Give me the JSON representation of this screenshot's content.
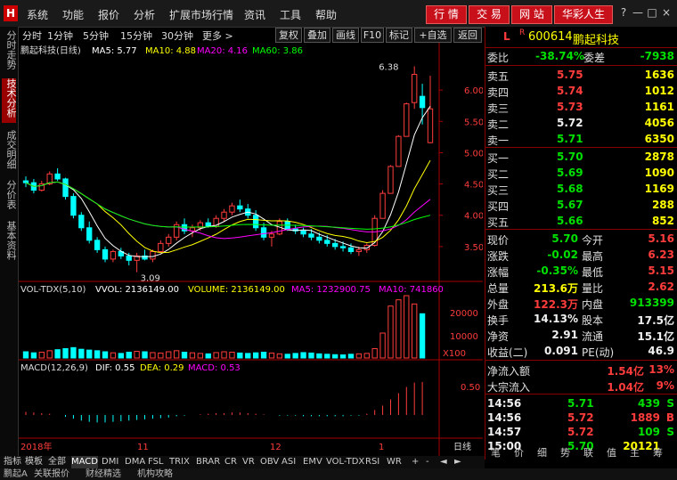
{
  "menubar": {
    "items": [
      "系统",
      "功能",
      "报价",
      "分析",
      "扩展市场行情",
      "资讯",
      "工具",
      "帮助"
    ],
    "buttons": [
      "行 情",
      "交 易",
      "网 站",
      "华彩人生"
    ],
    "controls": [
      "?",
      "—",
      "□",
      "×"
    ]
  },
  "left_tabs": [
    "分时走势",
    "技术分析",
    "成交明细",
    "分价表",
    "基本资料"
  ],
  "periods": [
    "分时",
    "1分钟",
    "5分钟",
    "15分钟",
    "30分钟",
    "更多 >"
  ],
  "tools": [
    "复权",
    "叠加",
    "画线",
    "F10",
    "标记",
    "+自选",
    "返回"
  ],
  "chart_header": {
    "name": "鹏起科技(日线)",
    "ma5": "MA5: 5.77",
    "ma10": "MA10: 4.88",
    "ma20": "MA20: 4.16",
    "ma60": "MA60: 3.86"
  },
  "price_axis": [
    "6.00",
    "5.50",
    "5.00",
    "4.50",
    "4.00",
    "3.50"
  ],
  "annotations": {
    "high": "6.38",
    "low": "3.09"
  },
  "vol_header": {
    "name": "VOL-TDX(5,10)",
    "vvol": "VVOL: 2136149.00",
    "volume": "VOLUME: 2136149.00",
    "ma5": "MA5: 1232900.75",
    "ma10": "MA10: 741860"
  },
  "vol_axis": [
    "20000",
    "10000"
  ],
  "vol_unit": "X100",
  "macd_header": {
    "name": "MACD(12,26,9)",
    "dif": "DIF: 0.55",
    "dea": "DEA: 0.29",
    "macd": "MACD: 0.53"
  },
  "macd_axis": [
    "0.50"
  ],
  "date_axis": [
    "2018年",
    "11",
    "12",
    "1"
  ],
  "date_unit": "日线",
  "bottom_tabs": [
    "指标",
    "模板",
    "全部",
    "MACD",
    "DMI",
    "DMA",
    "FSL",
    "TRIX",
    "BRAR",
    "CR",
    "VR",
    "OBV",
    "ASI",
    "EMV",
    "VOL-TDX",
    "RSI",
    "WR"
  ],
  "bottom_controls": [
    "+",
    "-",
    "◄",
    "►"
  ],
  "status_items": [
    "鹏起A",
    "关联报价",
    "财经精选",
    "机构攻略"
  ],
  "stock": {
    "code": "600614",
    "name": "鹏起科技",
    "badge": "L",
    "r": "R"
  },
  "commission": {
    "label1": "委比",
    "value1": "-38.74%",
    "label2": "委差",
    "value2": "-7938"
  },
  "asks": [
    {
      "label": "卖五",
      "price": "5.75",
      "vol": "1636"
    },
    {
      "label": "卖四",
      "price": "5.74",
      "vol": "1012"
    },
    {
      "label": "卖三",
      "price": "5.73",
      "vol": "1161"
    },
    {
      "label": "卖二",
      "price": "5.72",
      "vol": "4056"
    },
    {
      "label": "卖一",
      "price": "5.71",
      "vol": "6350"
    }
  ],
  "bids": [
    {
      "label": "买一",
      "price": "5.70",
      "vol": "2878"
    },
    {
      "label": "买二",
      "price": "5.69",
      "vol": "1090"
    },
    {
      "label": "买三",
      "price": "5.68",
      "vol": "1169"
    },
    {
      "label": "买四",
      "price": "5.67",
      "vol": "288"
    },
    {
      "label": "买五",
      "price": "5.66",
      "vol": "852"
    }
  ],
  "quote": [
    {
      "l1": "现价",
      "v1": "5.70",
      "l2": "今开",
      "v2": "5.16"
    },
    {
      "l1": "涨跌",
      "v1": "-0.02",
      "l2": "最高",
      "v2": "6.23"
    },
    {
      "l1": "涨幅",
      "v1": "-0.35%",
      "l2": "最低",
      "v2": "5.15"
    },
    {
      "l1": "总量",
      "v1": "213.6万",
      "l2": "量比",
      "v2": "2.62"
    },
    {
      "l1": "外盘",
      "v1": "122.3万",
      "l2": "内盘",
      "v2": "913399"
    },
    {
      "l1": "换手",
      "v1": "14.13%",
      "l2": "股本",
      "v2": "17.5亿"
    },
    {
      "l1": "净资",
      "v1": "2.91",
      "l2": "流通",
      "v2": "15.1亿"
    },
    {
      "l1": "收益(二)",
      "v1": "0.091",
      "l2": "PE(动)",
      "v2": "46.9"
    }
  ],
  "flows": [
    {
      "label": "净流入额",
      "value": "1.54亿",
      "pct": "13%"
    },
    {
      "label": "大宗流入",
      "value": "1.04亿",
      "pct": "9%"
    }
  ],
  "ticks": [
    {
      "time": "14:56",
      "price": "5.71",
      "vol": "439",
      "side": "S"
    },
    {
      "time": "14:56",
      "price": "5.72",
      "vol": "1889",
      "side": "B"
    },
    {
      "time": "14:57",
      "price": "5.72",
      "vol": "109",
      "side": "S"
    },
    {
      "time": "15:00",
      "price": "5.70",
      "vol": "20121",
      "side": ""
    }
  ],
  "right_bottom_tabs": [
    "笔",
    "价",
    "细",
    "势",
    "联",
    "值",
    "主",
    "筹"
  ],
  "colors": {
    "up": "#ff3c3c",
    "down": "#00ffff",
    "ma5": "#ffffff",
    "ma10": "#ffff00",
    "ma20": "#ff00ff",
    "ma60": "#00ff00"
  },
  "chart_data": {
    "type": "candlestick",
    "series": [
      {
        "o": 4.55,
        "h": 4.62,
        "l": 4.45,
        "c": 4.52
      },
      {
        "o": 4.52,
        "h": 4.58,
        "l": 4.35,
        "c": 4.4
      },
      {
        "o": 4.4,
        "h": 4.55,
        "l": 4.38,
        "c": 4.5
      },
      {
        "o": 4.5,
        "h": 4.7,
        "l": 4.48,
        "c": 4.66
      },
      {
        "o": 4.66,
        "h": 4.75,
        "l": 4.55,
        "c": 4.58
      },
      {
        "o": 4.58,
        "h": 4.6,
        "l": 4.25,
        "c": 4.3
      },
      {
        "o": 4.3,
        "h": 4.35,
        "l": 3.95,
        "c": 4.0
      },
      {
        "o": 4.0,
        "h": 4.05,
        "l": 3.75,
        "c": 3.8
      },
      {
        "o": 3.8,
        "h": 3.9,
        "l": 3.55,
        "c": 3.6
      },
      {
        "o": 3.6,
        "h": 3.65,
        "l": 3.4,
        "c": 3.45
      },
      {
        "o": 3.45,
        "h": 3.5,
        "l": 3.25,
        "c": 3.3
      },
      {
        "o": 3.3,
        "h": 3.45,
        "l": 3.25,
        "c": 3.42
      },
      {
        "o": 3.42,
        "h": 3.48,
        "l": 3.3,
        "c": 3.35
      },
      {
        "o": 3.35,
        "h": 3.4,
        "l": 3.2,
        "c": 3.28
      },
      {
        "o": 3.28,
        "h": 3.4,
        "l": 3.09,
        "c": 3.35
      },
      {
        "o": 3.35,
        "h": 3.45,
        "l": 3.28,
        "c": 3.3
      },
      {
        "o": 3.3,
        "h": 3.45,
        "l": 3.25,
        "c": 3.42
      },
      {
        "o": 3.42,
        "h": 3.6,
        "l": 3.4,
        "c": 3.55
      },
      {
        "o": 3.55,
        "h": 3.7,
        "l": 3.5,
        "c": 3.65
      },
      {
        "o": 3.65,
        "h": 3.9,
        "l": 3.6,
        "c": 3.85
      },
      {
        "o": 3.85,
        "h": 3.95,
        "l": 3.7,
        "c": 3.75
      },
      {
        "o": 3.75,
        "h": 3.85,
        "l": 3.65,
        "c": 3.8
      },
      {
        "o": 3.8,
        "h": 3.92,
        "l": 3.75,
        "c": 3.88
      },
      {
        "o": 3.88,
        "h": 3.95,
        "l": 3.8,
        "c": 3.82
      },
      {
        "o": 3.82,
        "h": 4.0,
        "l": 3.8,
        "c": 3.95
      },
      {
        "o": 3.95,
        "h": 4.1,
        "l": 3.9,
        "c": 4.05
      },
      {
        "o": 4.05,
        "h": 4.2,
        "l": 4.0,
        "c": 4.15
      },
      {
        "o": 4.15,
        "h": 4.25,
        "l": 4.05,
        "c": 4.1
      },
      {
        "o": 4.1,
        "h": 4.18,
        "l": 3.95,
        "c": 4.0
      },
      {
        "o": 4.0,
        "h": 4.08,
        "l": 3.75,
        "c": 3.8
      },
      {
        "o": 3.8,
        "h": 3.88,
        "l": 3.6,
        "c": 3.65
      },
      {
        "o": 3.65,
        "h": 3.75,
        "l": 3.5,
        "c": 3.7
      },
      {
        "o": 3.7,
        "h": 3.95,
        "l": 3.68,
        "c": 3.9
      },
      {
        "o": 3.9,
        "h": 3.95,
        "l": 3.75,
        "c": 3.78
      },
      {
        "o": 3.78,
        "h": 3.85,
        "l": 3.7,
        "c": 3.75
      },
      {
        "o": 3.75,
        "h": 3.8,
        "l": 3.65,
        "c": 3.7
      },
      {
        "o": 3.7,
        "h": 3.78,
        "l": 3.6,
        "c": 3.65
      },
      {
        "o": 3.65,
        "h": 3.72,
        "l": 3.55,
        "c": 3.6
      },
      {
        "o": 3.6,
        "h": 3.68,
        "l": 3.5,
        "c": 3.55
      },
      {
        "o": 3.55,
        "h": 3.62,
        "l": 3.45,
        "c": 3.5
      },
      {
        "o": 3.5,
        "h": 3.58,
        "l": 3.42,
        "c": 3.48
      },
      {
        "o": 3.48,
        "h": 3.55,
        "l": 3.38,
        "c": 3.42
      },
      {
        "o": 3.42,
        "h": 3.5,
        "l": 3.35,
        "c": 3.45
      },
      {
        "o": 3.45,
        "h": 3.55,
        "l": 3.4,
        "c": 3.52
      },
      {
        "o": 3.52,
        "h": 4.0,
        "l": 3.5,
        "c": 3.95
      },
      {
        "o": 3.95,
        "h": 4.4,
        "l": 3.95,
        "c": 4.35
      },
      {
        "o": 4.35,
        "h": 4.8,
        "l": 4.35,
        "c": 4.78
      },
      {
        "o": 4.78,
        "h": 5.28,
        "l": 4.78,
        "c": 5.26
      },
      {
        "o": 5.26,
        "h": 5.8,
        "l": 5.26,
        "c": 5.78
      },
      {
        "o": 5.8,
        "h": 6.38,
        "l": 5.7,
        "c": 6.25
      },
      {
        "o": 5.9,
        "h": 6.1,
        "l": 5.45,
        "c": 5.72
      },
      {
        "o": 5.16,
        "h": 6.23,
        "l": 5.15,
        "c": 5.7
      }
    ],
    "ylim": [
      3.0,
      6.5
    ],
    "volume": [
      30,
      25,
      28,
      35,
      40,
      45,
      50,
      42,
      38,
      35,
      30,
      25,
      22,
      28,
      32,
      30,
      26,
      24,
      30,
      35,
      28,
      25,
      22,
      20,
      26,
      30,
      28,
      24,
      22,
      25,
      28,
      24,
      20,
      18,
      22,
      26,
      24,
      20,
      18,
      16,
      15,
      18,
      20,
      22,
      45,
      120,
      250,
      280,
      300,
      260,
      213
    ],
    "macd": [
      0.05,
      0.04,
      0.03,
      0.02,
      0.0,
      -0.03,
      -0.06,
      -0.09,
      -0.11,
      -0.12,
      -0.12,
      -0.11,
      -0.1,
      -0.09,
      -0.08,
      -0.07,
      -0.06,
      -0.05,
      -0.04,
      -0.02,
      -0.01,
      0.0,
      0.01,
      0.02,
      0.03,
      0.03,
      0.04,
      0.04,
      0.03,
      0.02,
      0.01,
      0.0,
      -0.01,
      -0.01,
      -0.01,
      -0.02,
      -0.02,
      -0.02,
      -0.02,
      -0.02,
      -0.02,
      -0.01,
      -0.01,
      0.02,
      0.08,
      0.15,
      0.25,
      0.35,
      0.45,
      0.52,
      0.53
    ]
  }
}
